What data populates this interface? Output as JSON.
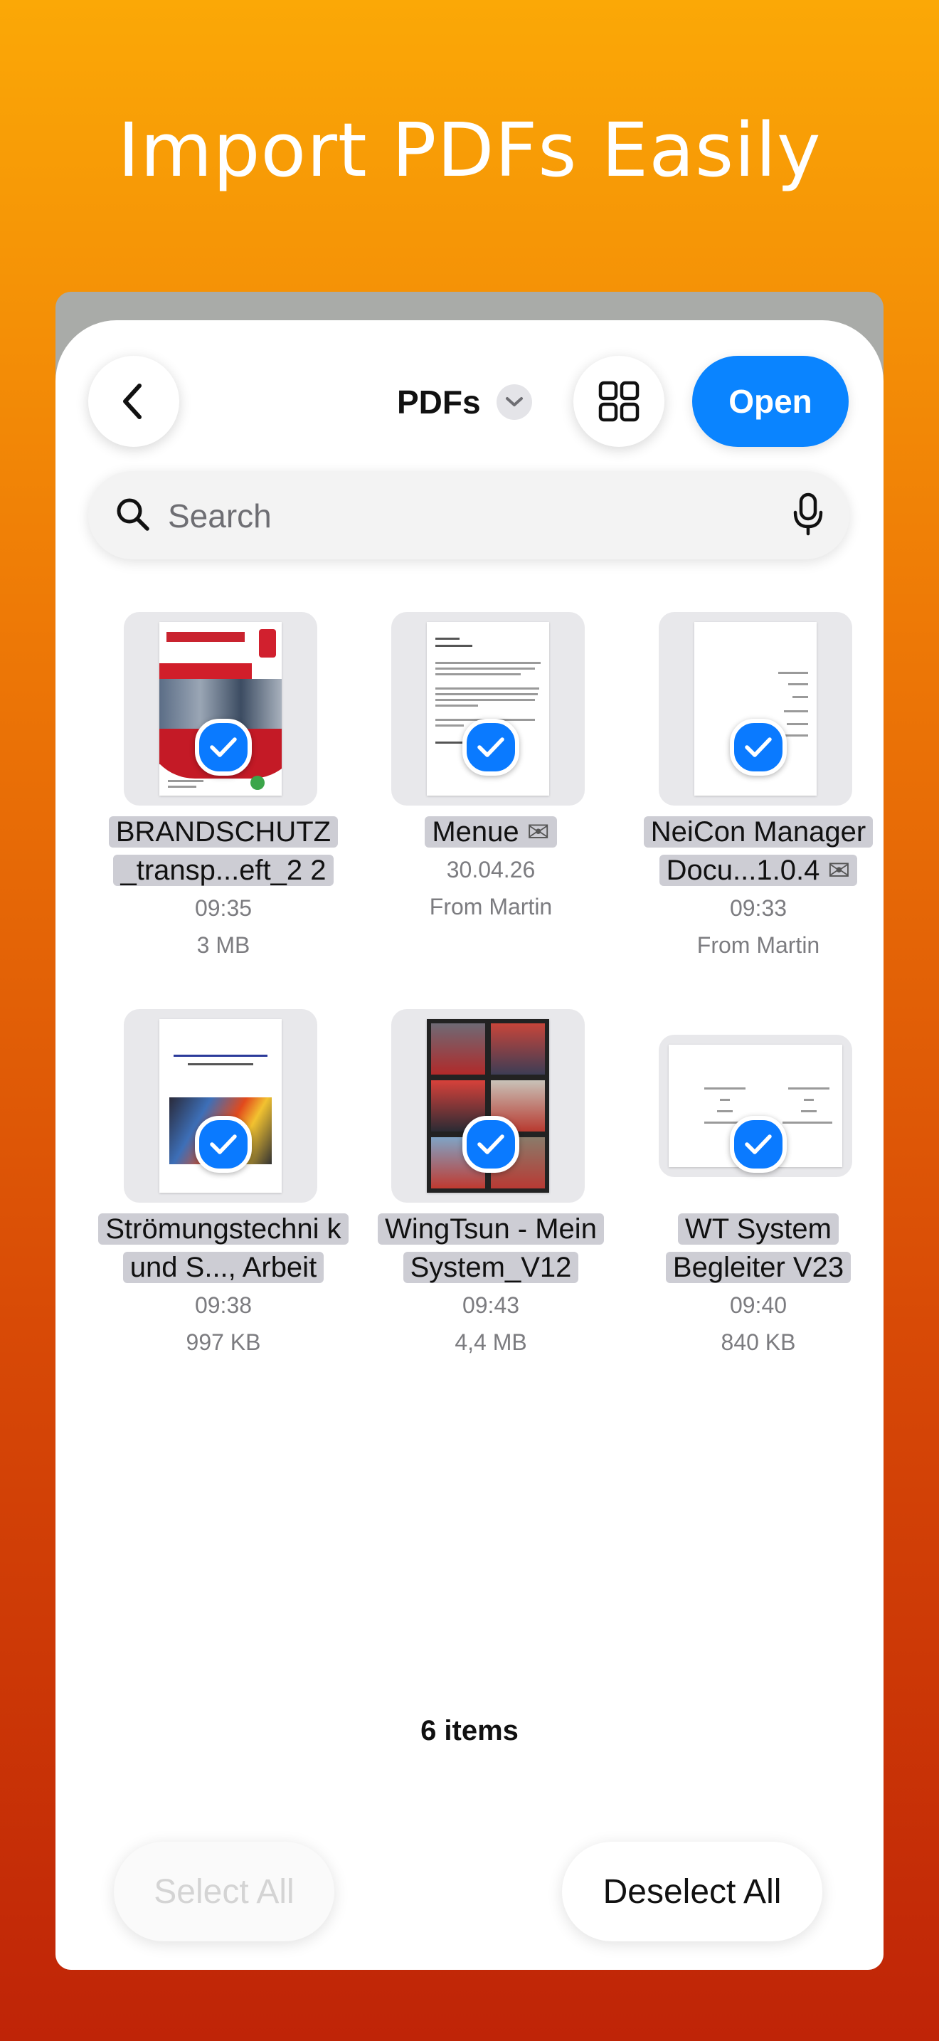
{
  "headline": "Import PDFs Easily",
  "header": {
    "title": "PDFs",
    "open_label": "Open"
  },
  "search": {
    "placeholder": "Search"
  },
  "files": [
    {
      "name": "BRANDSCHUTZ _transp...eft_2 2",
      "meta1": "09:35",
      "meta2": "3 MB",
      "selected": true
    },
    {
      "name": "Menue",
      "mail_icon": "envelope-icon",
      "meta1": "30.04.26",
      "meta2": "From Martin",
      "selected": true
    },
    {
      "name": "NeiCon Manager Docu...1.0.4",
      "mail_icon": "envelope-icon",
      "meta1": "09:33",
      "meta2": "From Martin",
      "selected": true
    },
    {
      "name": "Strömungstechni k und S..., Arbeit",
      "meta1": "09:38",
      "meta2": "997 KB",
      "selected": true
    },
    {
      "name": "WingTsun - Mein System_V12",
      "meta1": "09:43",
      "meta2": "4,4 MB",
      "selected": true
    },
    {
      "name": "WT System Begleiter V23",
      "meta1": "09:40",
      "meta2": "840 KB",
      "selected": true
    }
  ],
  "footer": {
    "items_count": "6 items",
    "select_all_label": "Select All",
    "deselect_all_label": "Deselect All"
  },
  "colors": {
    "accent": "#0A84FF",
    "gradient_top": "#FBA806",
    "gradient_bottom": "#BF2407"
  }
}
